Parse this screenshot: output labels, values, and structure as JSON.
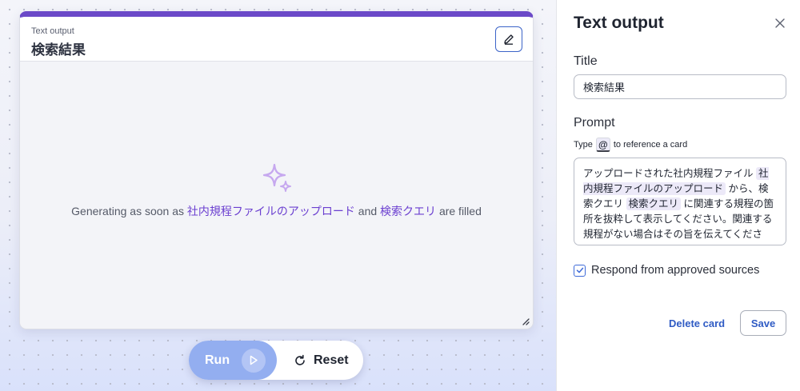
{
  "canvas": {
    "card": {
      "type_label": "Text output",
      "title": "検索結果",
      "generating": {
        "prefix": "Generating as soon as",
        "ref1": "社内規程ファイルのアップロード",
        "join": "and",
        "ref2": "検索クエリ",
        "suffix": "are filled"
      },
      "icons": {
        "edit": "pencil-icon",
        "placeholder": "sparkle-icon",
        "resize": "resize-grip-icon"
      }
    },
    "controls": {
      "run_label": "Run",
      "reset_label": "Reset",
      "icons": {
        "run": "play-icon",
        "reset": "refresh-icon"
      }
    }
  },
  "panel": {
    "title": "Text output",
    "close_icon": "close-icon",
    "title_field": {
      "label": "Title",
      "value": "検索結果"
    },
    "prompt_field": {
      "label": "Prompt",
      "hint_prefix": "Type",
      "hint_key": "@",
      "hint_suffix": "to reference a card",
      "text_1": "アップロードされた社内規程ファイル",
      "ref_1": "社内規程ファイルのアップロード",
      "text_2": "から、検索クエリ",
      "ref_2": "検索クエリ",
      "text_3": "に関連する規程の箇所を抜粋して表示してください。関連する規程がない場合はその旨を伝えてください。"
    },
    "approved_sources": {
      "label": "Respond from approved sources",
      "checked": true
    },
    "delete_label": "Delete card",
    "save_label": "Save"
  },
  "colors": {
    "accent_purple": "#6b49c8",
    "link_blue": "#2f5bc4",
    "run_blue": "#93aef0",
    "reference_purple": "#6b3fd0"
  }
}
